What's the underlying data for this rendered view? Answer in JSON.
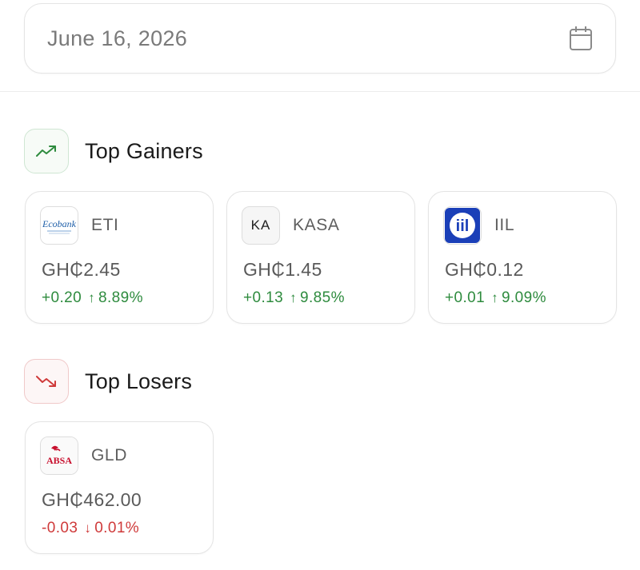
{
  "date_picker": {
    "value": "June 16, 2026",
    "icon": "calendar-icon"
  },
  "sections": {
    "gainers": {
      "title": "Top Gainers",
      "icon": "trending-up-icon",
      "color": "#2e8b3e",
      "stocks": [
        {
          "ticker": "ETI",
          "logo_text": "Ecobank",
          "price": "GH₵2.45",
          "change": "+0.20",
          "arrow": "↑",
          "percent": "8.89%"
        },
        {
          "ticker": "KASA",
          "logo_text": "KA",
          "price": "GH₵1.45",
          "change": "+0.13",
          "arrow": "↑",
          "percent": "9.85%"
        },
        {
          "ticker": "IIL",
          "logo_text": "iil",
          "price": "GH₵0.12",
          "change": "+0.01",
          "arrow": "↑",
          "percent": "9.09%"
        }
      ]
    },
    "losers": {
      "title": "Top Losers",
      "icon": "trending-down-icon",
      "color": "#cf3a3a",
      "stocks": [
        {
          "ticker": "GLD",
          "logo_text": "ABSA",
          "price": "GH₵462.00",
          "change": "-0.03",
          "arrow": "↓",
          "percent": "0.01%"
        }
      ]
    }
  }
}
